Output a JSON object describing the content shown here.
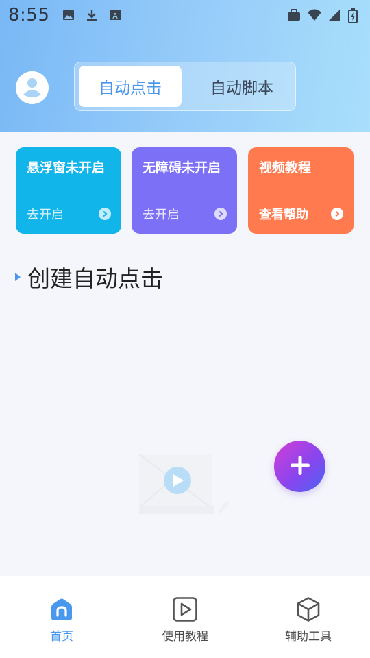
{
  "status_bar": {
    "time": "8:55",
    "left_icons": [
      "image-icon",
      "download-icon",
      "font-icon"
    ],
    "right_icons": [
      "briefcase-icon",
      "wifi-icon",
      "signal-icon",
      "battery-charging-icon"
    ]
  },
  "header": {
    "avatar_icon": "user-avatar-icon",
    "tabs": [
      {
        "label": "自动点击",
        "active": true
      },
      {
        "label": "自动脚本",
        "active": false
      }
    ]
  },
  "cards": [
    {
      "title": "悬浮窗未开启",
      "action": "去开启",
      "color": "#12b5ea"
    },
    {
      "title": "无障碍未开启",
      "action": "去开启",
      "color": "#7c70f6"
    },
    {
      "title": "视频教程",
      "action": "查看帮助",
      "color": "#ff7a4f"
    }
  ],
  "section": {
    "title": "创建自动点击"
  },
  "fab": {
    "icon": "plus-icon"
  },
  "bottom_nav": [
    {
      "label": "首页",
      "icon": "home-icon",
      "active": true
    },
    {
      "label": "使用教程",
      "icon": "play-tutorial-icon",
      "active": false
    },
    {
      "label": "辅助工具",
      "icon": "cube-tool-icon",
      "active": false
    }
  ],
  "colors": {
    "accent": "#4a97ee",
    "header_gradient_start": "#79b8f6",
    "header_gradient_end": "#a9dffb"
  }
}
